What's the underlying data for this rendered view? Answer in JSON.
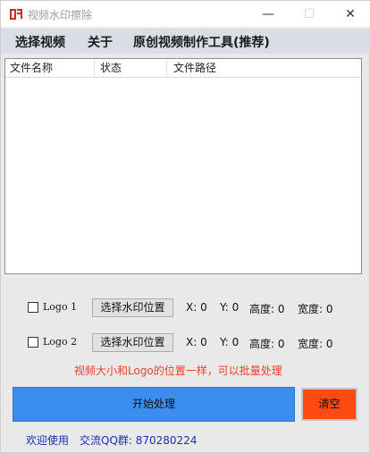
{
  "window": {
    "title": "视频水印擦除",
    "controls": {
      "minimize": "—",
      "maximize": "☐",
      "close": "✕"
    }
  },
  "menu": {
    "items": [
      "选择视频",
      "关于",
      "原创视频制作工具(推荐)"
    ]
  },
  "table": {
    "columns": [
      "文件名称",
      "状态",
      "文件路径"
    ],
    "rows": []
  },
  "logos": [
    {
      "label": "Logo 1",
      "checked": false,
      "button": "选择水印位置",
      "x": "X: 0",
      "y": "Y: 0",
      "height": "高度: 0",
      "width": "宽度: 0"
    },
    {
      "label": "Logo 2",
      "checked": false,
      "button": "选择水印位置",
      "x": "X: 0",
      "y": "Y: 0",
      "height": "高度: 0",
      "width": "宽度: 0"
    }
  ],
  "hint": "视频大小和Logo的位置一样，可以批量处理",
  "actions": {
    "start": "开始处理",
    "clear": "清空"
  },
  "footer": {
    "welcome": "欢迎使用",
    "qq_group": "交流QQ群: 870280224"
  },
  "colors": {
    "start_button": "#3b8ef0",
    "clear_button": "#ff4a12",
    "hint_text": "#e8412c",
    "footer_text": "#1a2eaa",
    "menubar": "#d8dde6"
  }
}
